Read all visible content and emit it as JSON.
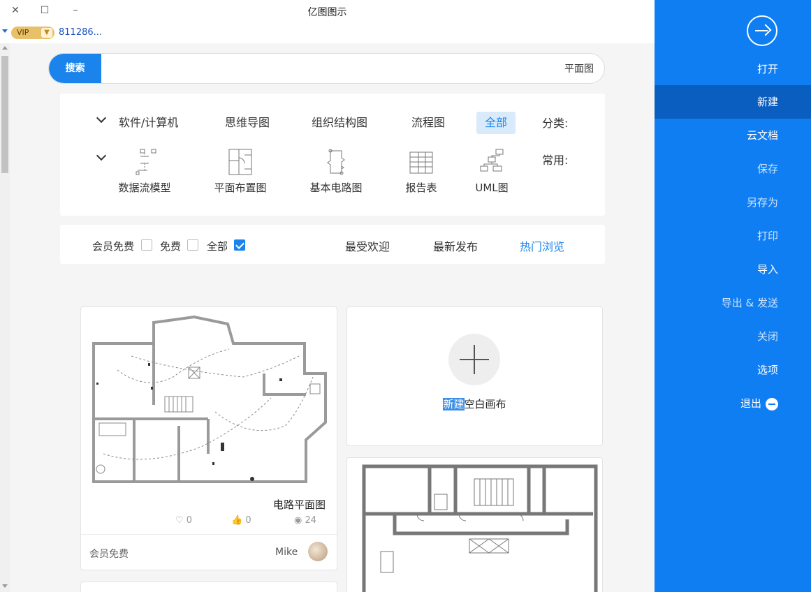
{
  "window": {
    "title": "亿图图示",
    "close_glyph": "✕",
    "maximize_glyph": "☐",
    "minimize_glyph": "–"
  },
  "user": {
    "vip_label": "VIP",
    "id_text": "811286..."
  },
  "search": {
    "button_label": "搜索",
    "value": "平面图"
  },
  "category": {
    "row_label": "分类:",
    "items": [
      "全部",
      "流程图",
      "组织结构图",
      "思维导图",
      "软件/计算机"
    ],
    "active_index": 0
  },
  "common": {
    "row_label": "常用:",
    "items": [
      {
        "label": "UML图",
        "icon": "uml-icon"
      },
      {
        "label": "报告表",
        "icon": "report-table-icon"
      },
      {
        "label": "基本电路图",
        "icon": "circuit-icon"
      },
      {
        "label": "平面布置图",
        "icon": "floor-plan-icon"
      },
      {
        "label": "数据流模型",
        "icon": "data-flow-icon"
      }
    ]
  },
  "sort_tabs": {
    "items": [
      "热门浏览",
      "最新发布",
      "最受欢迎"
    ],
    "active_index": 0
  },
  "price_filter": {
    "items": [
      {
        "label": "全部",
        "checked": true
      },
      {
        "label": "免费",
        "checked": false
      },
      {
        "label": "会员免费",
        "checked": false
      }
    ]
  },
  "new_canvas": {
    "label_highlight": "新建",
    "label_rest": "空白画布"
  },
  "templates": [
    {
      "title": "电路平面图",
      "views": "24",
      "likes": "0",
      "favorites": "0",
      "author": "Mike",
      "tag": "会员免费"
    }
  ],
  "sidebar": {
    "items": [
      {
        "label": "打开",
        "state": "normal"
      },
      {
        "label": "新建",
        "state": "active"
      },
      {
        "label": "云文档",
        "state": "normal"
      },
      {
        "label": "保存",
        "state": "dim"
      },
      {
        "label": "另存为",
        "state": "dim"
      },
      {
        "label": "打印",
        "state": "dim"
      },
      {
        "label": "导入",
        "state": "normal"
      },
      {
        "label": "导出 & 发送",
        "state": "dim"
      },
      {
        "label": "关闭",
        "state": "dim"
      },
      {
        "label": "选项",
        "state": "normal"
      },
      {
        "label": "退出",
        "state": "normal"
      }
    ]
  },
  "colors": {
    "accent": "#1a84ec",
    "sidebar_bg": "#0f7ef2",
    "sidebar_active": "#0a5ec0",
    "vip_gold": "#e8c06a"
  }
}
